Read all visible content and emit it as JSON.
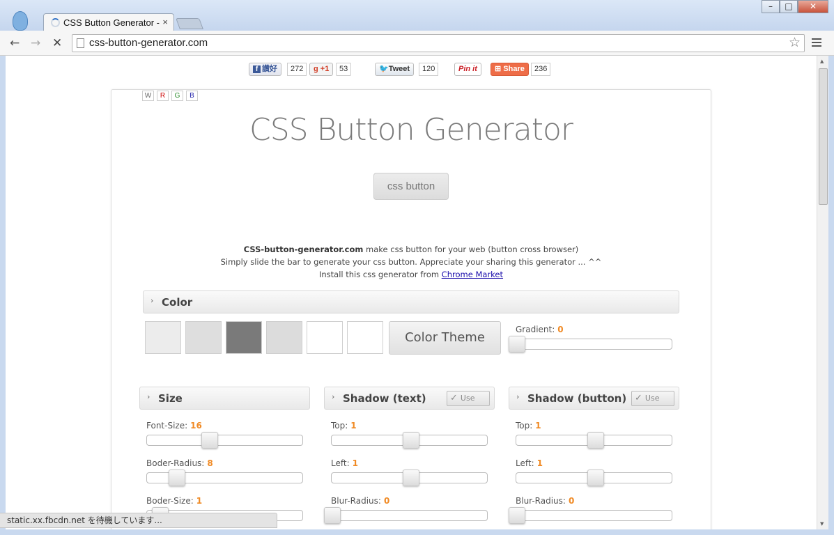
{
  "browser": {
    "tab_title": "CSS Button Generator - ",
    "tab_close": "×",
    "url": "css-button-generator.com",
    "status_text": "static.xx.fbcdn.net を待機しています..."
  },
  "share": {
    "facebook_label": "讚好",
    "facebook_count": "272",
    "gplus_label": "+1",
    "gplus_count": "53",
    "twitter_label": "Tweet",
    "twitter_count": "120",
    "pinterest_label": "Pin it",
    "share_label": "Share",
    "share_count": "236"
  },
  "theme_letters": [
    "W",
    "R",
    "G",
    "B"
  ],
  "page": {
    "title": "CSS Button Generator",
    "preview_button": "css button",
    "desc_site": "CSS-button-generator.com",
    "desc_line1_rest": " make css button for your web (button cross browser)",
    "desc_line2": "Simply slide the bar to generate your css button. Appreciate your sharing this generator ... ^^",
    "desc_line3_prefix": "Install this css generator from ",
    "desc_link": "Chrome Market"
  },
  "color_panel": {
    "title": "Color",
    "swatches": [
      "#ececec",
      "#dedede",
      "#7a7a7a",
      "#dcdcdc",
      "#ffffff",
      "#ffffff"
    ],
    "theme_button": "Color Theme",
    "gradient_label": "Gradient:",
    "gradient_value": "0"
  },
  "size_panel": {
    "title": "Size",
    "font_size_label": "Font-Size:",
    "font_size_value": "16",
    "border_radius_label": "Boder-Radius:",
    "border_radius_value": "8",
    "border_size_label": "Boder-Size:",
    "border_size_value": "1"
  },
  "text_shadow_panel": {
    "title": "Shadow (text)",
    "use_label": "Use",
    "top_label": "Top:",
    "top_value": "1",
    "left_label": "Left:",
    "left_value": "1",
    "blur_label": "Blur-Radius:",
    "blur_value": "0"
  },
  "button_shadow_panel": {
    "title": "Shadow (button)",
    "use_label": "Use",
    "top_label": "Top:",
    "top_value": "1",
    "left_label": "Left:",
    "left_value": "1",
    "blur_label": "Blur-Radius:",
    "blur_value": "0"
  }
}
